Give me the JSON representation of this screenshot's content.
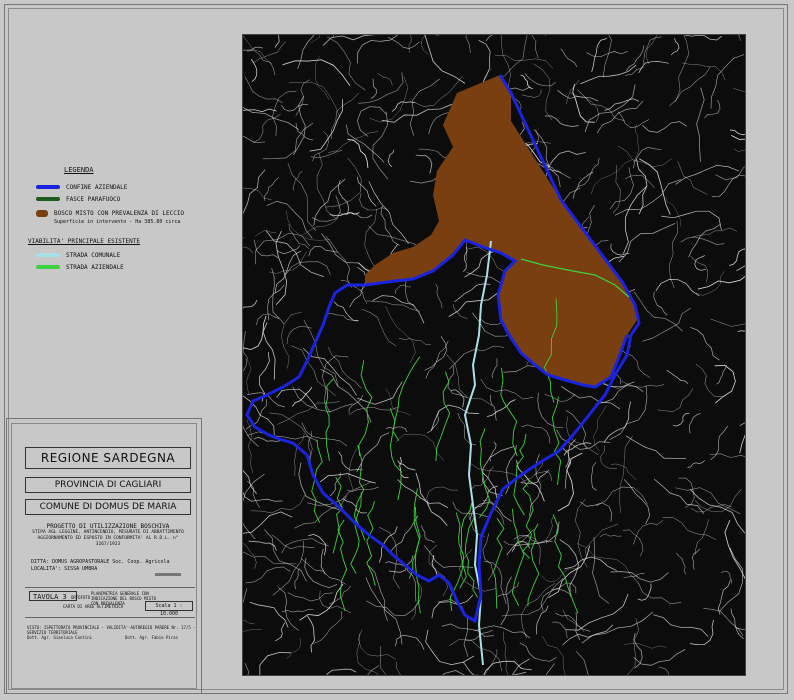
{
  "legend": {
    "title": "LEGENDA",
    "items": [
      {
        "label": "CONFINE AZIENDALE",
        "color": "#1a24e0",
        "kind": "line"
      },
      {
        "label": "FASCE PARAFUOCO",
        "color": "#1f5a1f",
        "kind": "line"
      },
      {
        "label": "BOSCO MISTO CON PREVALENZA DI LECCIO",
        "sub": "Superficie in intervento - Ha 385.80 circa",
        "color": "#7a3f10",
        "kind": "box"
      }
    ],
    "section_title": "VIABILITA' PRINCIPALE ESISTENTE",
    "roads": [
      {
        "label": "STRADA COMUNALE",
        "color": "#a8e0e8",
        "kind": "line"
      },
      {
        "label": "STRADA AZIENDALE",
        "color": "#3fd13f",
        "kind": "line"
      }
    ]
  },
  "title_block": {
    "region": "REGIONE SARDEGNA",
    "province": "PROVINCIA DI CAGLIARI",
    "comune": "COMUNE DI DOMUS DE MARIA",
    "project_title": "PROGETTO DI UTILIZZAZIONE BOSCHIVA",
    "project_lines": [
      "STIPA AGL LEGGINE, ANTINCENDIO, MISURATE DI ABBATTIMENTO",
      "AGGIORNAMENTO ED ESPOSTO IN CONFORMITA' AL R.D.L. n° 3267/1923"
    ],
    "ditta": "DITTA: DOMUS AGROPASTORALE Soc. Coop. Agricola",
    "localita": "LOCALITA': SISSA UMBRA",
    "tavola_label": "TAVOLA",
    "tavola_number": "3",
    "tavola_suffix": "ORTOFOTO",
    "drawing_desc": "PLANIMETRIA GENERALE CON INDICAZIONE DEL BOSCO MISTO CON PREVALENZA",
    "drawing_desc2": "CARTA DI AREE ALTIMETRICA",
    "scale": "Scala 1 : 10.000",
    "footer_line": "VISTO: ISPETTORATO PROVINCIALE - VALIDITA'-AUTOREGIO PARERE Nr. 17/5 - SERVIZIO TERRITORIALE",
    "author_left": "Dott. Agr. Gianluca Contini",
    "author_right": "Dott. Agr. Fabio Piras"
  },
  "colors": {
    "boundary": "#1a24e0",
    "forest": "#7a3f10",
    "comunale": "#a8e0e8",
    "aziendale": "#3fd13f",
    "contour": "#e8e8e8",
    "background": "#0c0c0c"
  }
}
